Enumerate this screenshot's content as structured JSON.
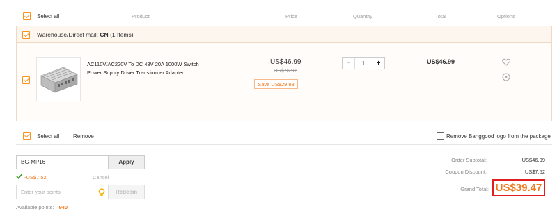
{
  "header": {
    "select_all": "Select all",
    "product": "Product",
    "price": "Price",
    "quantity": "Quantity",
    "total": "Total",
    "options": "Options"
  },
  "warehouse": {
    "label": "Warehouse/Direct mail:",
    "country": "CN",
    "count": "(1 Items)"
  },
  "item": {
    "name_line1": "AC110V/AC220V To DC 48V 20A 1000W Switch",
    "name_line2": "Power Supply Driver Transformer Adapter",
    "price": "US$46.99",
    "old_price": "US$76.97",
    "save": "Save US$29.98",
    "quantity": "1",
    "minus": "−",
    "plus": "+",
    "total": "US$46.99",
    "wishlist_icon": "heart-icon",
    "remove_icon": "close-circle-icon"
  },
  "footer_bar": {
    "select_all": "Select all",
    "remove": "Remove",
    "remove_logo": "Remove Banggood logo from the package"
  },
  "coupon": {
    "code": "BG-MP16",
    "apply": "Apply",
    "discount_applied": "-US$7.52",
    "cancel": "Cancel"
  },
  "points": {
    "placeholder": "Enter your points",
    "redeem": "Redeem",
    "available_label": "Available points:",
    "available_value": "940"
  },
  "summary": {
    "subtotal_label": "Order Subtotal:",
    "subtotal_value": "US$46.99",
    "discount_label": "Coupon Discount:",
    "discount_value": "US$7.52",
    "grand_label": "Grand Total:",
    "grand_value": "US$39.47"
  },
  "colors": {
    "accent": "#f7931e",
    "price_orange": "#f07a1e",
    "highlight_red": "#e02020",
    "success_green": "#3a9d23"
  }
}
